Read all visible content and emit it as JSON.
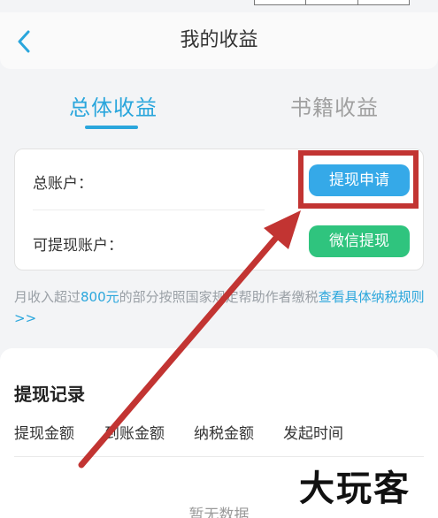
{
  "header": {
    "title": "我的收益",
    "back_icon": "chevron-left-icon"
  },
  "tabs": [
    {
      "label": "总体收益",
      "active": true
    },
    {
      "label": "书籍收益",
      "active": false
    }
  ],
  "account_card": {
    "total_account_label": "总账户：",
    "withdrawable_account_label": "可提现账户：",
    "apply_button": "提现申请",
    "wechat_button": "微信提现"
  },
  "notice": {
    "prefix": "月收入超过",
    "amount": "800元",
    "middle": "的部分按照国家规定帮助作者缴税",
    "link": "查看具体纳税规则>>"
  },
  "records": {
    "title": "提现记录",
    "columns": [
      "提现金额",
      "到账金额",
      "纳税金额",
      "发起时间"
    ],
    "empty_text": "暂无数据"
  },
  "watermark": "大玩客",
  "colors": {
    "accent": "#2aa6dc",
    "apply_button": "#35a9e8",
    "wechat_button": "#2fc47e",
    "annotation": "#c23432"
  }
}
